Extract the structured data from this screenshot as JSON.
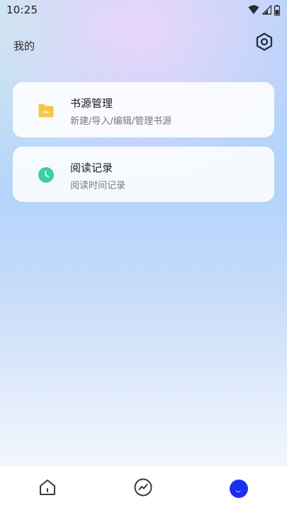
{
  "status_bar": {
    "time": "10:25",
    "icons": [
      "wifi-icon",
      "signal-icon",
      "battery-icon"
    ]
  },
  "header": {
    "title": "我的",
    "settings_icon": "settings-hexagon-icon"
  },
  "cards": [
    {
      "title": "书源管理",
      "subtitle": "新建/导入/编辑/管理书源",
      "icon": "folder-icon",
      "icon_color": "#f5c842"
    },
    {
      "title": "阅读记录",
      "subtitle": "阅读时间记录",
      "icon": "clock-icon",
      "icon_color": "#3fcf9a"
    }
  ],
  "bottom_nav": {
    "items": [
      {
        "icon": "home-icon",
        "active": false
      },
      {
        "icon": "discover-icon",
        "active": false
      },
      {
        "icon": "profile-icon",
        "active": true
      }
    ],
    "active_color": "#1a2ff0"
  }
}
